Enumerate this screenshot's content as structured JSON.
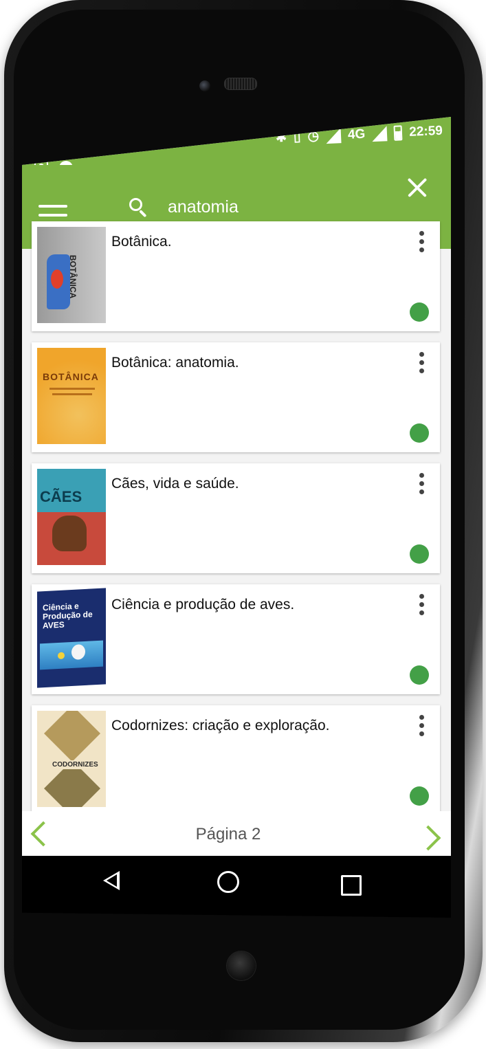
{
  "status_bar": {
    "network": "4G",
    "time": "22:59"
  },
  "search": {
    "query": "anatomia"
  },
  "books": [
    {
      "title": "Botânica.",
      "cover_text": "BOTÂNICA",
      "available": true
    },
    {
      "title": "Botânica: anatomia.",
      "cover_text": "BOTÂNICA",
      "available": true
    },
    {
      "title": "Cães, vida e saúde.",
      "cover_text": "CÃES",
      "available": true
    },
    {
      "title": "Ciência e produção de aves.",
      "cover_text": "Ciência e Produção de AVES",
      "available": true
    },
    {
      "title": "Codornizes: criação e exploração.",
      "cover_text": "CODORNIZES",
      "available": true
    }
  ],
  "pagination": {
    "label": "Página 2"
  },
  "colors": {
    "primary": "#7cb342",
    "available_dot": "#43a047",
    "arrow": "#8bc34a"
  }
}
